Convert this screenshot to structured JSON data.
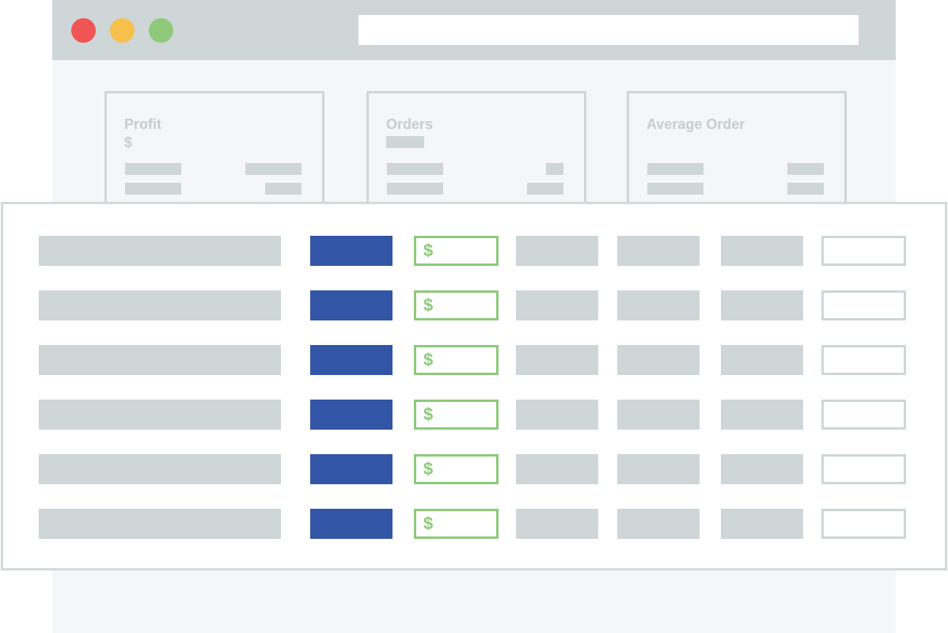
{
  "colors": {
    "titlebar": "#cfd6d8",
    "close_dot": "#f05454",
    "minimize_dot": "#f6c04d",
    "maximize_dot": "#8ec97c",
    "accent_blue": "#3355a5",
    "accent_green": "#8ec97c",
    "placeholder_gray": "#cfd6d8",
    "muted_text": "#c6cdd0"
  },
  "stats": [
    {
      "title": "Profit",
      "value": "$"
    },
    {
      "title": "Orders"
    },
    {
      "title": "Average Order"
    }
  ],
  "table": {
    "rows": [
      {
        "price_symbol": "$"
      },
      {
        "price_symbol": "$"
      },
      {
        "price_symbol": "$"
      },
      {
        "price_symbol": "$"
      },
      {
        "price_symbol": "$"
      },
      {
        "price_symbol": "$"
      }
    ]
  }
}
